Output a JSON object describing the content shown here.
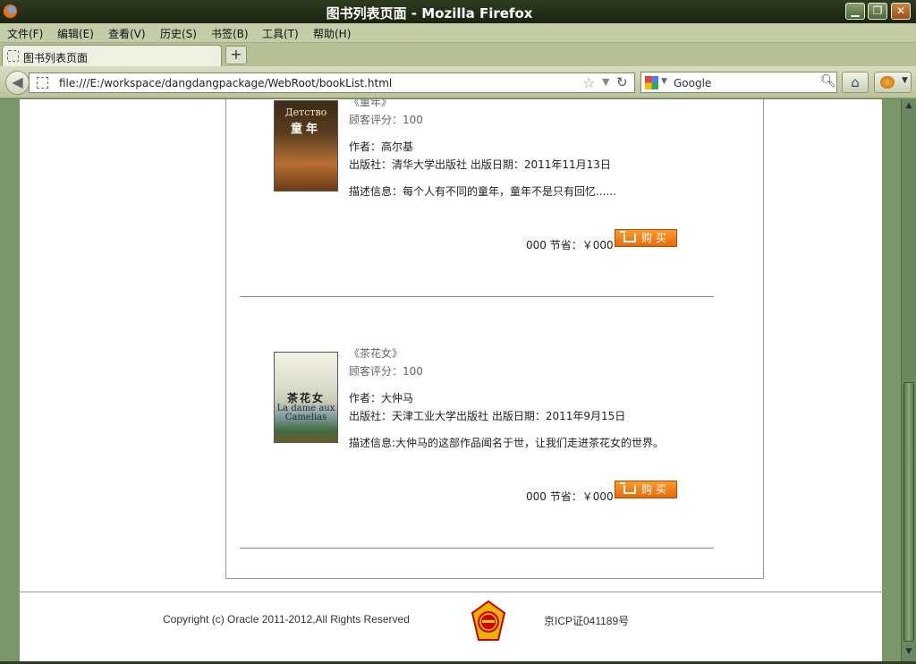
{
  "window": {
    "title": "图书列表页面 - Mozilla Firefox"
  },
  "menubar": {
    "items": [
      "文件(F)",
      "编辑(E)",
      "查看(V)",
      "历史(S)",
      "书签(B)",
      "工具(T)",
      "帮助(H)"
    ]
  },
  "tabs": [
    {
      "label": "图书列表页面"
    }
  ],
  "newtab": "+",
  "navbar": {
    "url": "file:///E:/workspace/dangdangpackage/WebRoot/bookList.html",
    "search_engine": "Google"
  },
  "books": [
    {
      "title": "《童年》",
      "rating": "顾客评分：100",
      "author": "作者：高尔基",
      "pubinfo": "出版社：清华大学出版社  出版日期：2011年11月13日",
      "desc": "描述信息：每个人有不同的童年，童年不是只有回忆......",
      "price": "000  节省：￥000",
      "buy_label": "购买",
      "cover_cyrillic": "Детство",
      "cover_chinese": "童年"
    },
    {
      "title": "《茶花女》",
      "rating": "顾客评分：100",
      "author": "作者：大仲马",
      "pubinfo": "出版社：天津工业大学出版社  出版日期：2011年9月15日",
      "desc": "描述信息:大仲马的这部作品闻名于世，让我们走进茶花女的世界。",
      "price": "000  节省：￥000",
      "buy_label": "购买",
      "cover_chinese": "茶花女",
      "cover_latin": "La dame aux Camelias"
    }
  ],
  "footer": {
    "copyright": "Copyright (c) Oracle 2011-2012,All Rights Reserved",
    "icp": "京ICP证041189号"
  },
  "colors": {
    "buy_button": "#f07d14",
    "theme_green": "#6f8b5f"
  }
}
